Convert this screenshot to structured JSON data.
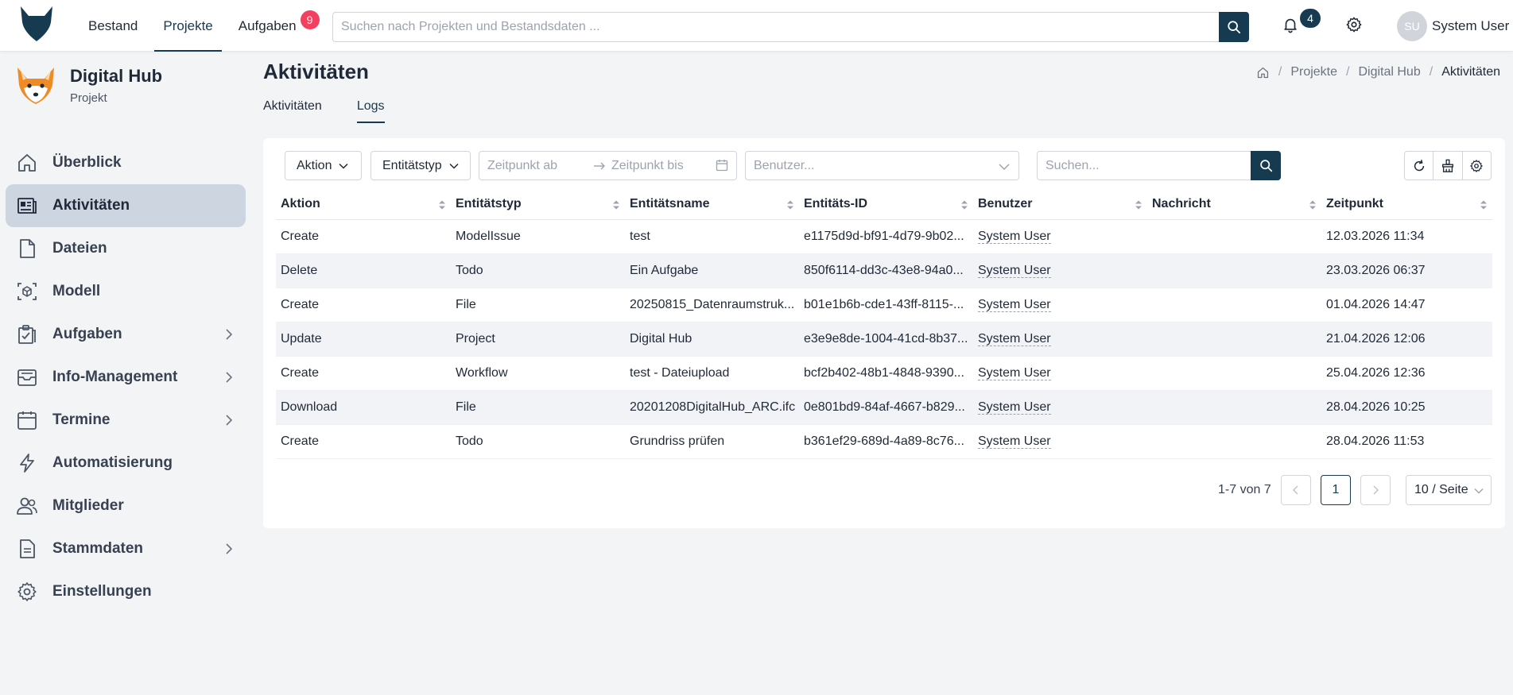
{
  "topnav": {
    "items": [
      {
        "label": "Bestand"
      },
      {
        "label": "Projekte"
      },
      {
        "label": "Aufgaben",
        "badge": "9"
      }
    ],
    "search_placeholder": "Suchen nach Projekten und Bestandsdaten ...",
    "notifications": "4",
    "user_initials": "SU",
    "user_name": "System User"
  },
  "project": {
    "title": "Digital Hub",
    "subtitle": "Projekt"
  },
  "sidebar": {
    "items": [
      {
        "label": "Überblick",
        "icon": "home-icon"
      },
      {
        "label": "Aktivitäten",
        "icon": "activity-icon"
      },
      {
        "label": "Dateien",
        "icon": "file-icon"
      },
      {
        "label": "Modell",
        "icon": "model-icon"
      },
      {
        "label": "Aufgaben",
        "icon": "clipboard-icon"
      },
      {
        "label": "Info-Management",
        "icon": "inbox-icon"
      },
      {
        "label": "Termine",
        "icon": "calendar-icon"
      },
      {
        "label": "Automatisierung",
        "icon": "lightning-icon"
      },
      {
        "label": "Mitglieder",
        "icon": "users-icon"
      },
      {
        "label": "Stammdaten",
        "icon": "document-icon"
      },
      {
        "label": "Einstellungen",
        "icon": "gear-icon"
      }
    ]
  },
  "page": {
    "title": "Aktivitäten",
    "breadcrumb": [
      "Projekte",
      "Digital Hub",
      "Aktivitäten"
    ],
    "tabs": [
      "Aktivitäten",
      "Logs"
    ]
  },
  "filters": {
    "action": "Aktion",
    "entity_type": "Entitätstyp",
    "date_from": "Zeitpunkt ab",
    "date_to": "Zeitpunkt bis",
    "user_placeholder": "Benutzer...",
    "search_placeholder": "Suchen..."
  },
  "table": {
    "headers": [
      "Aktion",
      "Entitätstyp",
      "Entitätsname",
      "Entitäts-ID",
      "Benutzer",
      "Nachricht",
      "Zeitpunkt"
    ],
    "rows": [
      [
        "Create",
        "ModelIssue",
        "test",
        "e1175d9d-bf91-4d79-9b02...",
        "System User",
        "",
        "12.03.2026 11:34"
      ],
      [
        "Delete",
        "Todo",
        "Ein Aufgabe",
        "850f6114-dd3c-43e8-94a0...",
        "System User",
        "",
        "23.03.2026 06:37"
      ],
      [
        "Create",
        "File",
        "20250815_Datenraumstruk...",
        "b01e1b6b-cde1-43ff-8115-...",
        "System User",
        "",
        "01.04.2026 14:47"
      ],
      [
        "Update",
        "Project",
        "Digital Hub",
        "e3e9e8de-1004-41cd-8b37...",
        "System User",
        "",
        "21.04.2026 12:06"
      ],
      [
        "Create",
        "Workflow",
        "test - Dateiupload",
        "bcf2b402-48b1-4848-9390...",
        "System User",
        "",
        "25.04.2026 12:36"
      ],
      [
        "Download",
        "File",
        "20201208DigitalHub_ARC.ifc",
        "0e801bd9-84af-4667-b829...",
        "System User",
        "",
        "28.04.2026 10:25"
      ],
      [
        "Create",
        "Todo",
        "Grundriss prüfen",
        "b361ef29-689d-4a89-8c76...",
        "System User",
        "",
        "28.04.2026 11:53"
      ]
    ]
  },
  "pagination": {
    "info": "1-7 von 7",
    "current": "1",
    "page_size": "10 / Seite"
  },
  "colors": {
    "primary": "#163a4f",
    "badge": "#f43f5e",
    "active_nav": "#cdd6e0"
  }
}
